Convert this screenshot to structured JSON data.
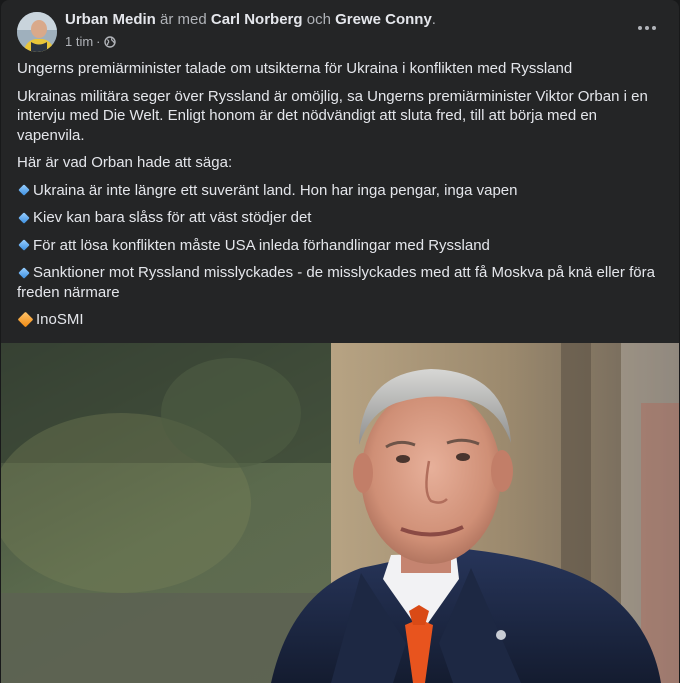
{
  "post": {
    "author": "Urban Medin",
    "with_text": "är med",
    "tagged_1": "Carl Norberg",
    "and_text": "och",
    "tagged_2": "Grewe Conny",
    "period": ".",
    "time": "1 tim",
    "dot": "·",
    "privacy_icon": "globe-icon",
    "more_icon": "more-options-icon",
    "paragraphs": [
      "Ungerns premiärminister talade om utsikterna för Ukraina i konflikten med Ryssland",
      "Ukrainas militära seger över Ryssland är omöjlig, sa Ungerns premiärminister Viktor Orban i en intervju med Die Welt. Enligt honom är det nödvändigt att sluta fred, till att börja med en vapenvila.",
      "Här är vad Orban hade att säga:"
    ],
    "bullets": [
      "Ukraina är inte längre ett suveränt land. Hon har inga pengar, inga vapen",
      "Kiev kan bara slåss för att väst stödjer det",
      "För att lösa konflikten måste USA inleda förhandlingar med Ryssland",
      "Sanktioner mot Ryssland misslyckades - de misslyckades med att få Moskva på knä eller föra freden närmare"
    ],
    "source": "InoSMI",
    "colors": {
      "card_bg": "#242526",
      "text_primary": "#e4e6eb",
      "text_secondary": "#b0b3b8",
      "bullet_blue": "#3b8fe0",
      "bullet_orange": "#f08a12",
      "tie_orange": "#e8541e",
      "suit_navy": "#1e2a44"
    }
  }
}
